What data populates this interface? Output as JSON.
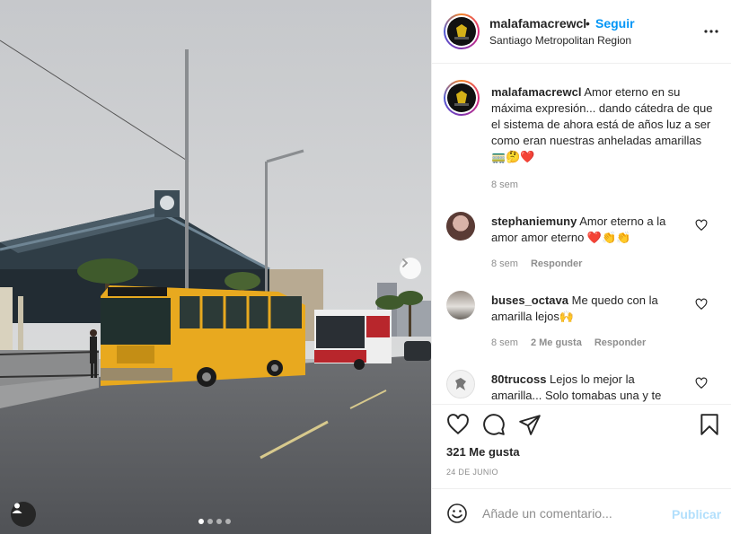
{
  "post": {
    "username": "malafamacrewcl",
    "separator": "•",
    "follow_label": "Seguir",
    "location": "Santiago Metropolitan Region",
    "more_icon": "more-options-icon",
    "carousel": {
      "slides": 4,
      "current": 1,
      "next_icon": "chevron-right-icon"
    },
    "user_tag_icon": "user-tag-icon"
  },
  "caption": {
    "username": "malafamacrewcl",
    "text": "Amor eterno en su máxima expresión... dando cátedra de que el sistema de ahora está de años luz a ser como eran nuestras anheladas amarillas 🚃🤔❤️",
    "time": "8 sem"
  },
  "comments": [
    {
      "username": "stephaniemuny",
      "text": "Amor eterno a la amor amor eterno ❤️👏👏",
      "time": "8 sem",
      "likes": "",
      "reply_label": "Responder"
    },
    {
      "username": "buses_octava",
      "text": "Me quedo con la amarilla lejos🙌",
      "time": "8 sem",
      "likes": "2 Me gusta",
      "reply_label": "Responder"
    },
    {
      "username": "80trucoss",
      "text": "Lejos lo mejor la amarilla... Solo tomabas una y te",
      "time": "",
      "likes": "",
      "reply_label": ""
    }
  ],
  "actions": {
    "like_icon": "heart-icon",
    "comment_icon": "comment-icon",
    "share_icon": "share-icon",
    "save_icon": "bookmark-icon"
  },
  "likes_text": "321 Me gusta",
  "date_text": "24 DE JUNIO",
  "comment_box": {
    "emoji_icon": "emoji-icon",
    "placeholder": "Añade un comentario...",
    "publish_label": "Publicar"
  },
  "colors": {
    "accent_blue": "#0095f6",
    "publish_disabled": "#b2dffc",
    "bus_yellow": "#e8a91f",
    "bus_red": "#b8262c"
  }
}
